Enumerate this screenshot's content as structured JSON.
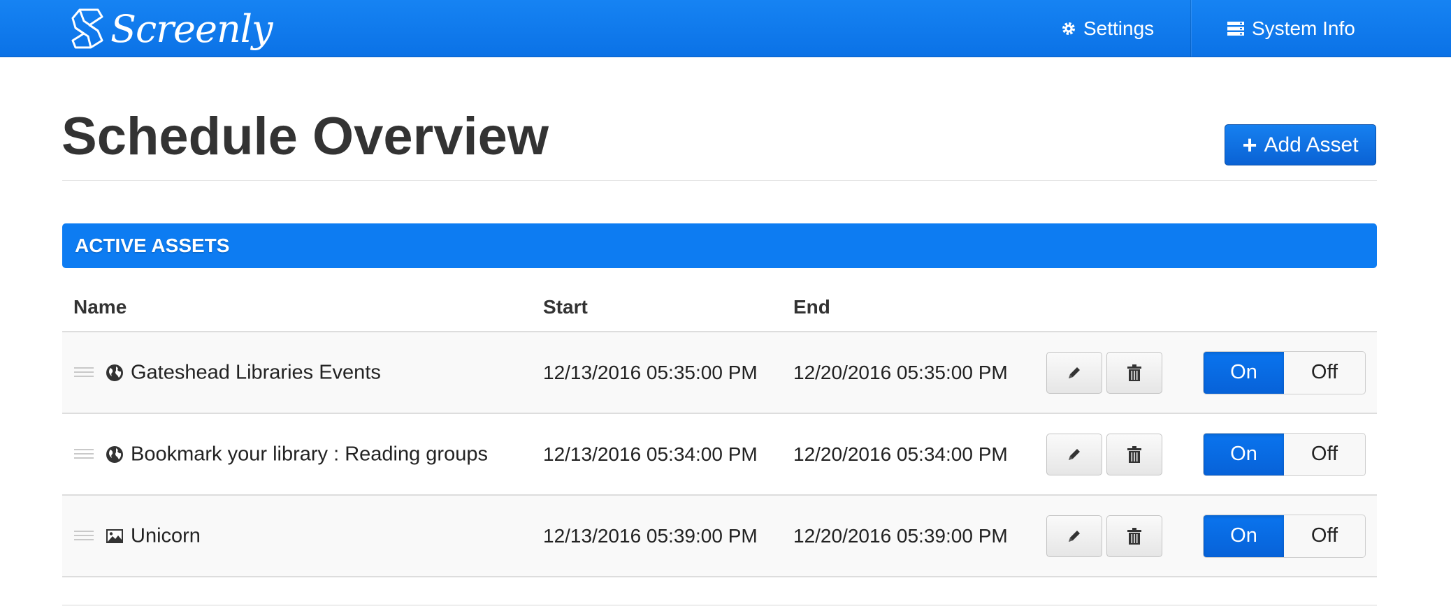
{
  "brand": {
    "name": "Screenly"
  },
  "nav": {
    "settings_label": "Settings",
    "sysinfo_label": "System Info"
  },
  "page": {
    "title": "Schedule Overview",
    "add_button_label": "Add Asset"
  },
  "section": {
    "title": "ACTIVE ASSETS"
  },
  "table": {
    "columns": {
      "name": "Name",
      "start": "Start",
      "end": "End"
    },
    "rows": [
      {
        "type_icon": "globe-icon",
        "name": "Gateshead Libraries Events",
        "start": "12/13/2016 05:35:00 PM",
        "end": "12/20/2016 05:35:00 PM",
        "on_label": "On",
        "off_label": "Off",
        "state": "on"
      },
      {
        "type_icon": "globe-icon",
        "name": "Bookmark your library : Reading groups",
        "start": "12/13/2016 05:34:00 PM",
        "end": "12/20/2016 05:34:00 PM",
        "on_label": "On",
        "off_label": "Off",
        "state": "on"
      },
      {
        "type_icon": "image-icon",
        "name": "Unicorn",
        "start": "12/13/2016 05:39:00 PM",
        "end": "12/20/2016 05:39:00 PM",
        "on_label": "On",
        "off_label": "Off",
        "state": "on"
      }
    ]
  },
  "colors": {
    "navbar": "#0b7ae9",
    "accent": "#0a72ec",
    "section_bar": "#0d7cf2"
  }
}
